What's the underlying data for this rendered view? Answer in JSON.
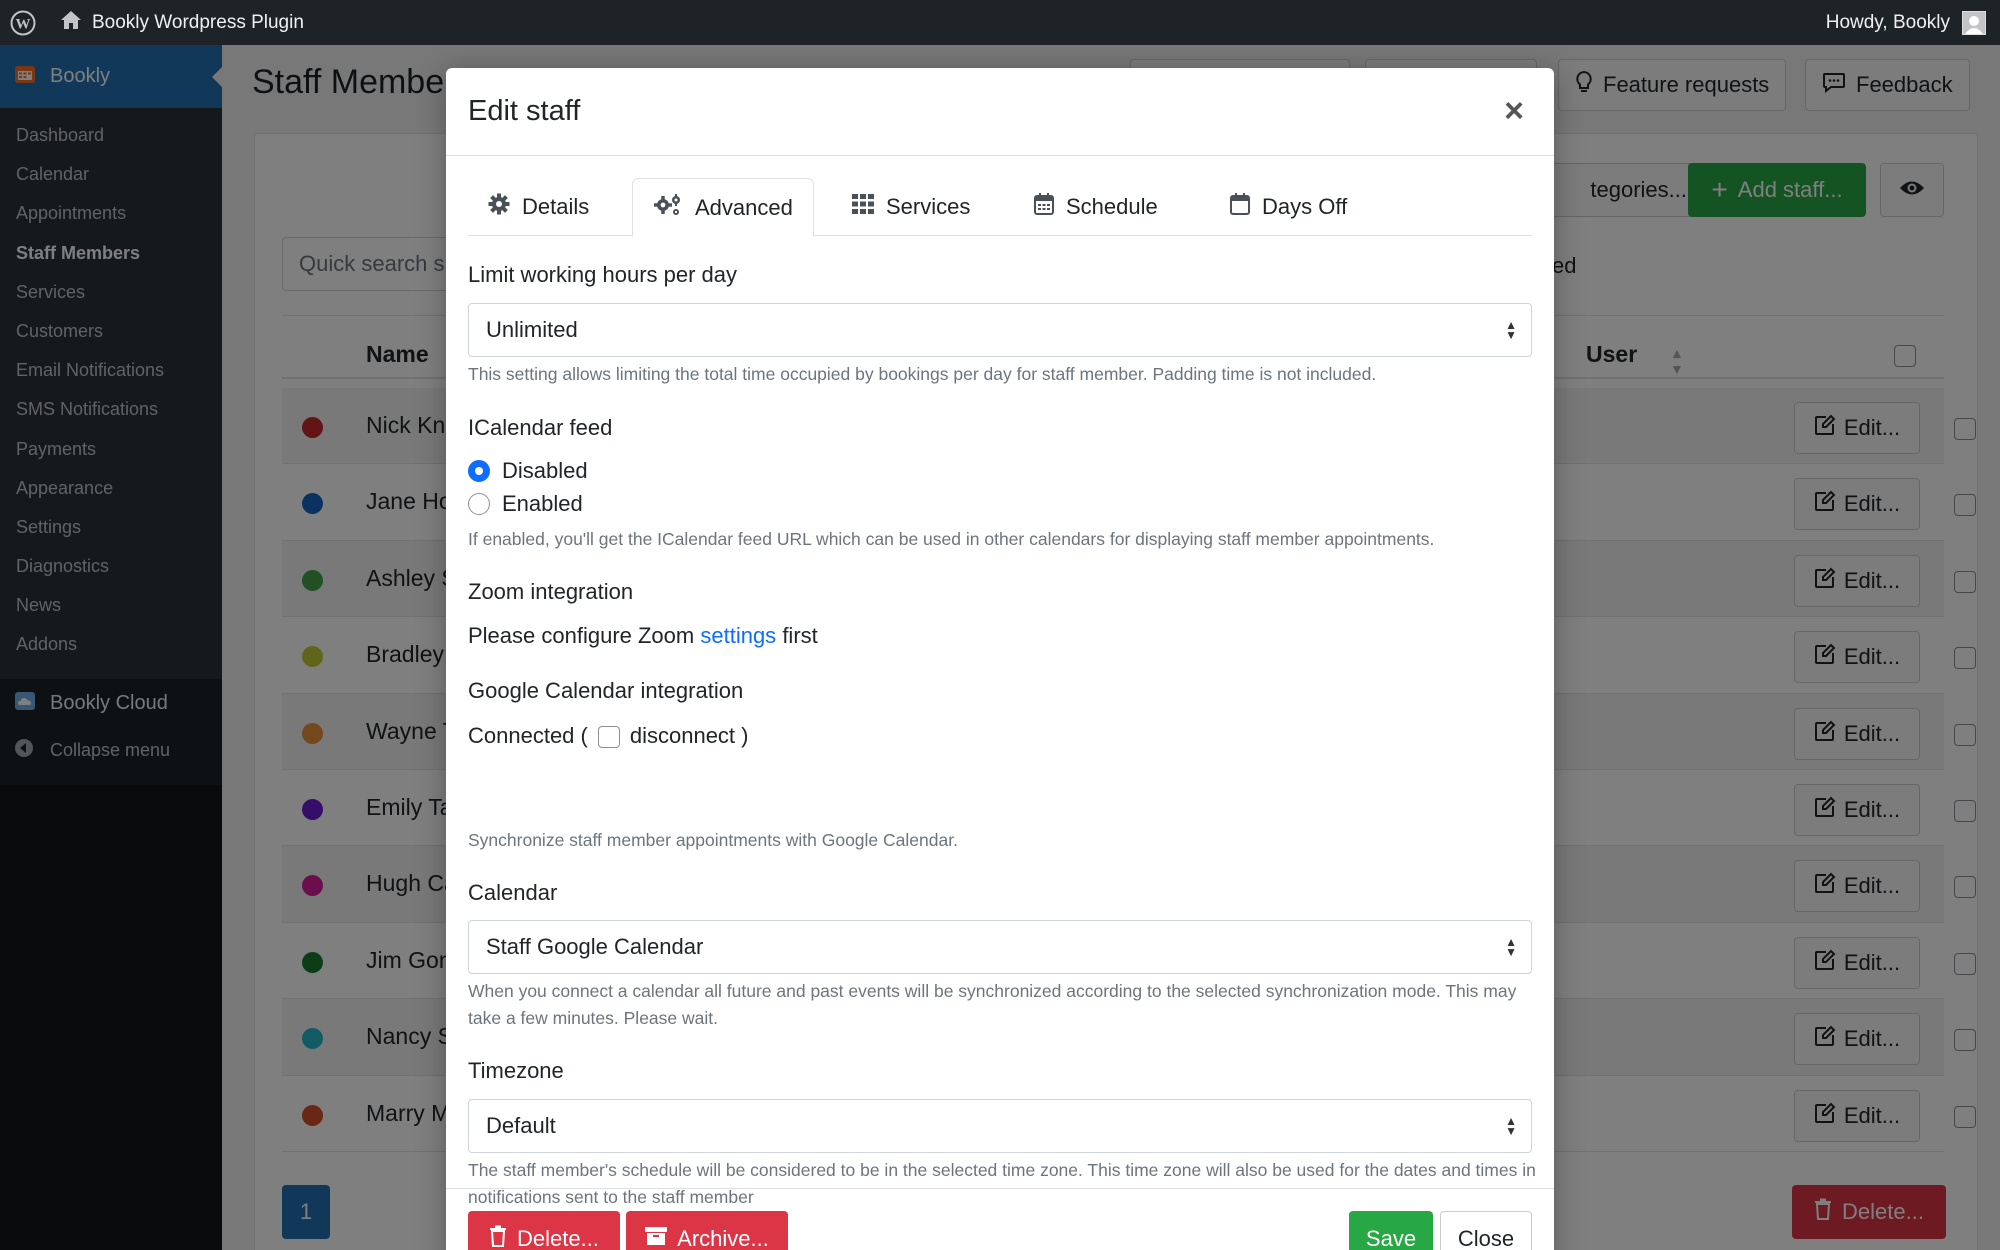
{
  "adminbar": {
    "site_title": "Bookly Wordpress Plugin",
    "howdy": "Howdy, Bookly"
  },
  "sidebar": {
    "plugin_label": "Bookly",
    "items": [
      {
        "label": "Dashboard",
        "active": false
      },
      {
        "label": "Calendar",
        "active": false
      },
      {
        "label": "Appointments",
        "active": false
      },
      {
        "label": "Staff Members",
        "active": true
      },
      {
        "label": "Services",
        "active": false
      },
      {
        "label": "Customers",
        "active": false
      },
      {
        "label": "Email Notifications",
        "active": false
      },
      {
        "label": "SMS Notifications",
        "active": false
      },
      {
        "label": "Payments",
        "active": false
      },
      {
        "label": "Appearance",
        "active": false
      },
      {
        "label": "Settings",
        "active": false
      },
      {
        "label": "Diagnostics",
        "active": false
      },
      {
        "label": "News",
        "active": false
      },
      {
        "label": "Addons",
        "active": false
      }
    ],
    "cloud_label": "Bookly Cloud",
    "collapse_label": "Collapse menu"
  },
  "page": {
    "title": "Staff Membe",
    "feature_requests": "Feature requests",
    "feedback": "Feedback",
    "categories_button": "tegories...",
    "add_staff_button": "Add staff...",
    "quick_search_placeholder": "Quick search s",
    "partial_text": "ed",
    "col_name": "Name",
    "col_user": "User",
    "edit_label": "Edit...",
    "pager_current": "1",
    "delete_label": "Delete...",
    "staff": [
      {
        "name": "Nick Kni",
        "color": "#c62828"
      },
      {
        "name": "Jane Ho",
        "color": "#1565c0"
      },
      {
        "name": "Ashley S",
        "color": "#43a047"
      },
      {
        "name": "Bradley",
        "color": "#c0ca33"
      },
      {
        "name": "Wayne T",
        "color": "#e69138"
      },
      {
        "name": "Emily Ta",
        "color": "#6a1bd4"
      },
      {
        "name": "Hugh Ca",
        "color": "#d81b9b"
      },
      {
        "name": "Jim Gon",
        "color": "#1b7a2e"
      },
      {
        "name": "Nancy S",
        "color": "#26b7c9"
      },
      {
        "name": "Marry M",
        "color": "#d1502b"
      }
    ]
  },
  "modal": {
    "title": "Edit staff",
    "tabs": [
      {
        "label": "Details",
        "icon": "gear-icon"
      },
      {
        "label": "Advanced",
        "icon": "gears-icon",
        "active": true
      },
      {
        "label": "Services",
        "icon": "grid-icon"
      },
      {
        "label": "Schedule",
        "icon": "calendar-week-icon"
      },
      {
        "label": "Days Off",
        "icon": "calendar-icon"
      }
    ],
    "working_hours": {
      "label": "Limit working hours per day",
      "value": "Unlimited",
      "help": "This setting allows limiting the total time occupied by bookings per day for staff member. Padding time is not included."
    },
    "icalendar": {
      "label": "ICalendar feed",
      "options": [
        "Disabled",
        "Enabled"
      ],
      "selected": "Disabled",
      "help": "If enabled, you'll get the ICalendar feed URL which can be used in other calendars for displaying staff member appointments."
    },
    "zoom": {
      "label": "Zoom integration",
      "text_before": "Please configure Zoom",
      "link": "settings",
      "text_after": "first"
    },
    "google": {
      "label": "Google Calendar integration",
      "connected_text": "Connected (",
      "disconnect_text": "disconnect )",
      "help": "Synchronize staff member appointments with Google Calendar."
    },
    "calendar": {
      "label": "Calendar",
      "value": "Staff Google Calendar",
      "help": "When you connect a calendar all future and past events will be synchronized according to the selected synchronization mode. This may take a few minutes. Please wait."
    },
    "timezone": {
      "label": "Timezone",
      "value": "Default",
      "help": "The staff member's schedule will be considered to be in the selected time zone. This time zone will also be used for the dates and times in notifications sent to the staff member"
    },
    "footer": {
      "delete": "Delete...",
      "archive": "Archive...",
      "save": "Save",
      "close": "Close"
    }
  },
  "colors": {
    "accent": "#2271b1",
    "primary": "#0d6efd",
    "success": "#28a745",
    "danger": "#dc3545",
    "admin_dark": "#1d2327"
  }
}
